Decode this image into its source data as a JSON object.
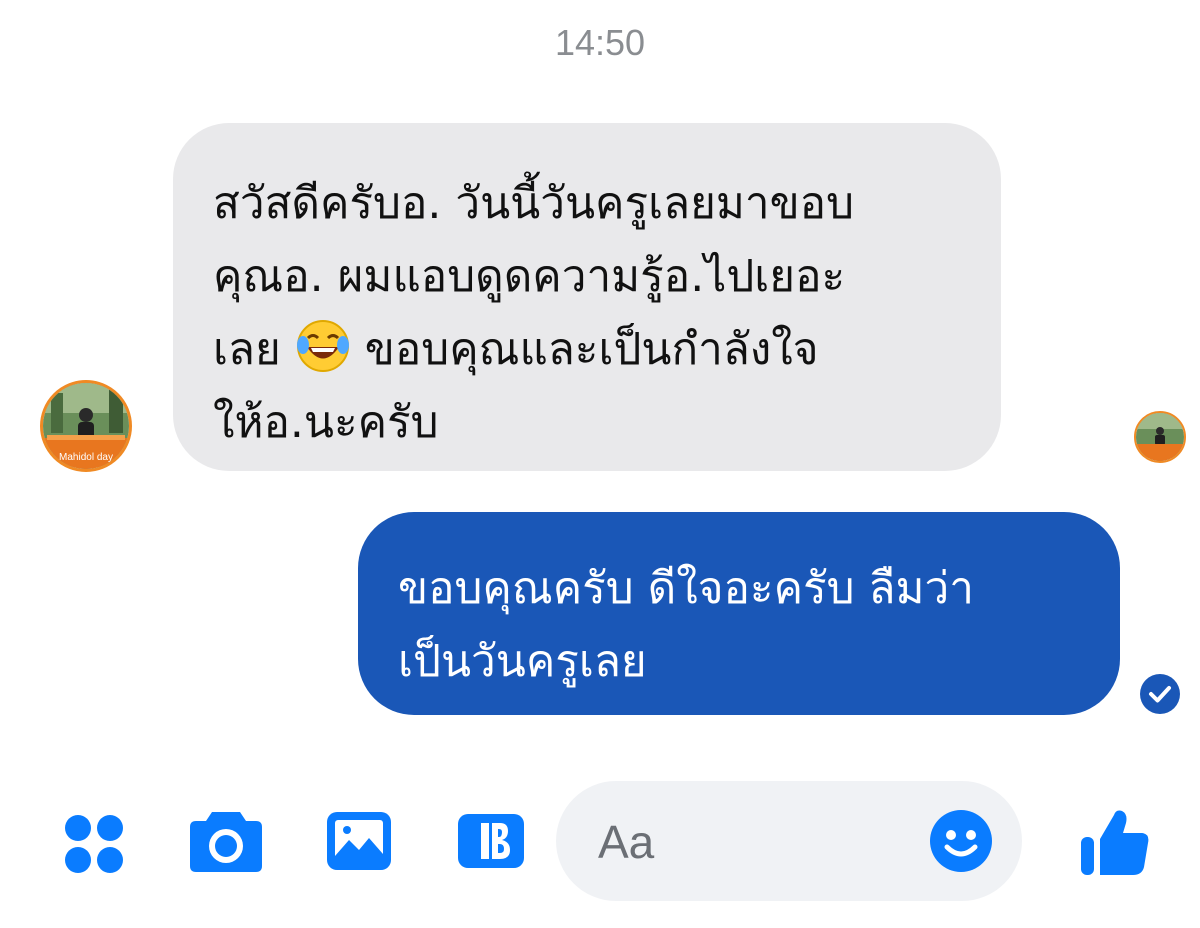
{
  "conversation": {
    "timestamp": "14:50",
    "incoming_message": {
      "lines": [
        "สวัสดีครับอ. วันนี้วันครูเลยมาขอบ",
        "คุณอ. ผมแอบดูดความรู้อ.ไปเยอะ",
        "เลย",
        "ขอบคุณและเป็นกำลังใจ",
        "ให้อ.นะครับ"
      ],
      "emoji": "face-with-tears-of-joy"
    },
    "outgoing_message": {
      "lines": [
        "ขอบคุณครับ ดีใจอะครับ ลืมว่า",
        "เป็นวันครูเลย"
      ]
    },
    "avatar_caption": "Mahidol day"
  },
  "composer": {
    "placeholder": "Aa"
  },
  "icons": {
    "toolbar": [
      "apps-icon",
      "camera-icon",
      "gallery-icon",
      "gif-icon"
    ],
    "emoji_button": "emoji-icon",
    "like_button": "thumbs-up-icon",
    "seen": "check-icon"
  },
  "colors": {
    "accent": "#0a7cff",
    "outgoing_bubble": "#1a57b7",
    "incoming_bubble": "#e9e9eb",
    "composer_bg": "#f0f2f5",
    "timestamp": "#8a8d91"
  }
}
